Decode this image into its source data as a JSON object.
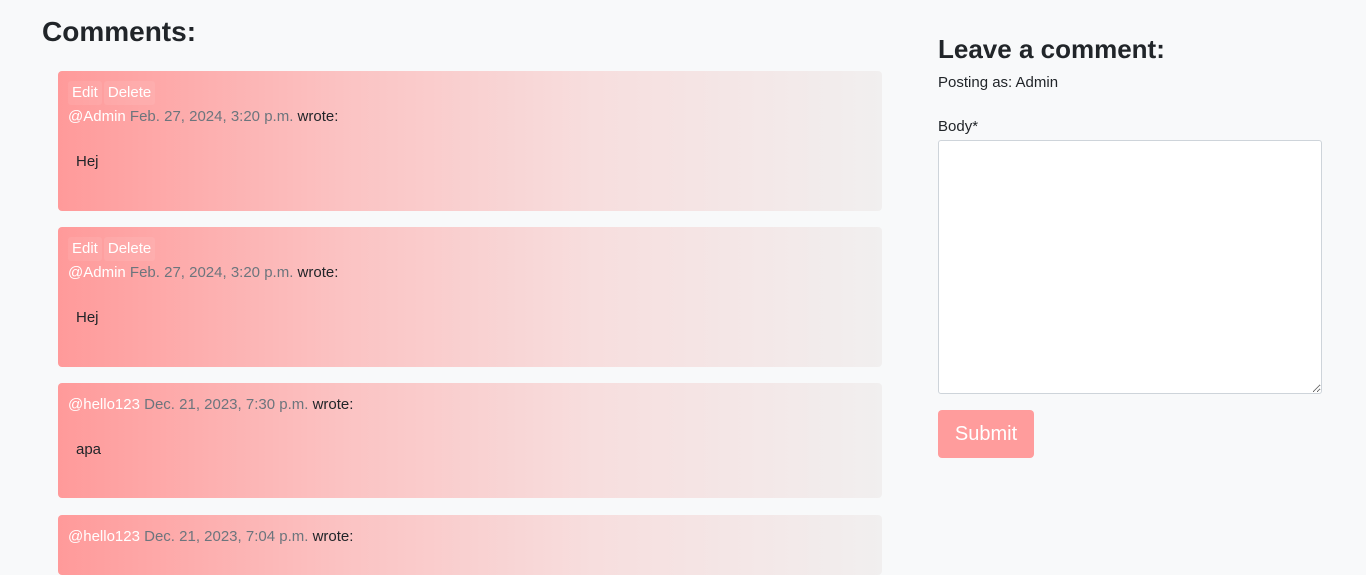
{
  "comments_section": {
    "heading": "Comments:",
    "comments": [
      {
        "edit_label": "Edit",
        "delete_label": "Delete",
        "author": "@Admin",
        "date": "Feb. 27, 2024, 3:20 p.m.",
        "wrote": "wrote:",
        "body": "Hej"
      },
      {
        "edit_label": "Edit",
        "delete_label": "Delete",
        "author": "@Admin",
        "date": "Feb. 27, 2024, 3:20 p.m.",
        "wrote": "wrote:",
        "body": "Hej"
      },
      {
        "author": "@hello123",
        "date": "Dec. 21, 2023, 7:30 p.m.",
        "wrote": "wrote:",
        "body": "apa"
      },
      {
        "author": "@hello123",
        "date": "Dec. 21, 2023, 7:04 p.m.",
        "wrote": "wrote:",
        "body": ""
      }
    ]
  },
  "comment_form": {
    "heading": "Leave a comment:",
    "posting_as": "Posting as: Admin",
    "body_label": "Body*",
    "body_value": "",
    "submit_label": "Submit"
  },
  "colors": {
    "accent": "#ff9c9c",
    "card_gradient_start": "#ff9a9a",
    "card_gradient_end": "#f1efef",
    "page_background": "#f8f9fa"
  }
}
